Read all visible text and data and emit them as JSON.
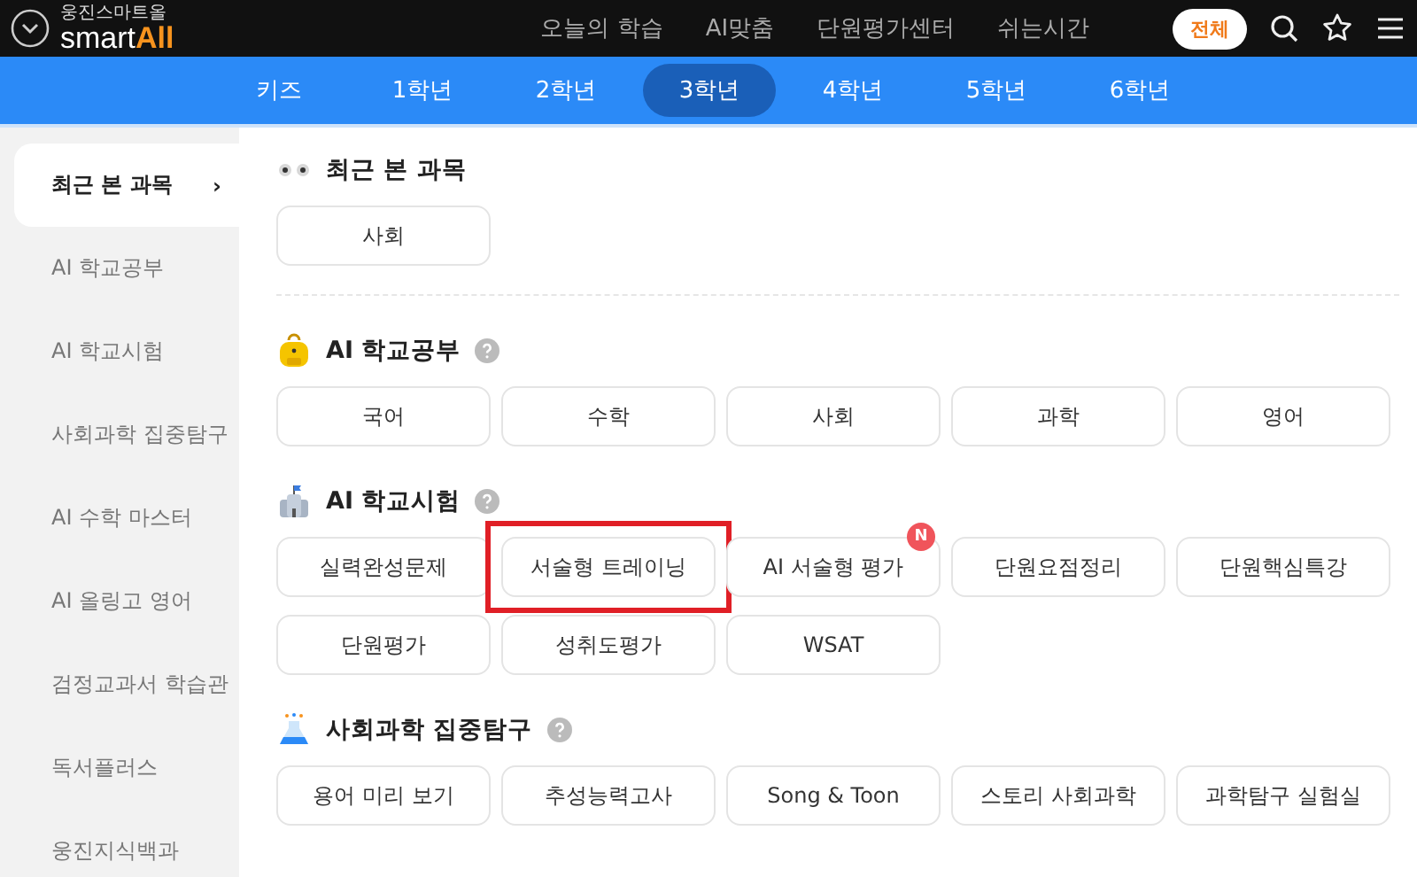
{
  "header": {
    "logo_caption": "웅진스마트올",
    "logo_text": "smart",
    "logo_accent": "All",
    "nav": [
      "오늘의 학습",
      "AI맞춤",
      "단원평가센터",
      "쉬는시간"
    ],
    "all_button": "전체"
  },
  "grades": [
    {
      "label": "키즈",
      "selected": false
    },
    {
      "label": "1학년",
      "selected": false
    },
    {
      "label": "2학년",
      "selected": false
    },
    {
      "label": "3학년",
      "selected": true
    },
    {
      "label": "4학년",
      "selected": false
    },
    {
      "label": "5학년",
      "selected": false
    },
    {
      "label": "6학년",
      "selected": false
    }
  ],
  "sidebar": [
    {
      "label": "최근 본 과목",
      "selected": true,
      "arrow": "›"
    },
    {
      "label": "AI 학교공부",
      "selected": false
    },
    {
      "label": "AI 학교시험",
      "selected": false
    },
    {
      "label": "사회과학 집중탐구",
      "selected": false
    },
    {
      "label": "AI 수학 마스터",
      "selected": false
    },
    {
      "label": "AI 올링고 영어",
      "selected": false
    },
    {
      "label": "검정교과서 학습관",
      "selected": false
    },
    {
      "label": "독서플러스",
      "selected": false
    },
    {
      "label": "웅진지식백과",
      "selected": false
    }
  ],
  "sections": [
    {
      "title": "최근 본 과목",
      "kind": "eyes",
      "help": false,
      "divider": true,
      "buttons": [
        {
          "label": "사회"
        }
      ]
    },
    {
      "title": "AI 학교공부",
      "kind": "bag",
      "help": true,
      "divider": false,
      "buttons": [
        {
          "label": "국어"
        },
        {
          "label": "수학"
        },
        {
          "label": "사회"
        },
        {
          "label": "과학"
        },
        {
          "label": "영어"
        }
      ]
    },
    {
      "title": "AI 학교시험",
      "kind": "school",
      "help": true,
      "divider": false,
      "buttons": [
        {
          "label": "실력완성문제"
        },
        {
          "label": "서술형 트레이닝",
          "highlighted": true
        },
        {
          "label": "AI 서술형 평가",
          "badge": "N"
        },
        {
          "label": "단원요점정리"
        },
        {
          "label": "단원핵심특강"
        },
        {
          "label": "단원평가"
        },
        {
          "label": "성취도평가"
        },
        {
          "label": "WSAT"
        }
      ]
    },
    {
      "title": "사회과학 집중탐구",
      "kind": "flask",
      "help": true,
      "divider": false,
      "buttons": [
        {
          "label": "용어 미리 보기"
        },
        {
          "label": "추성능력고사"
        },
        {
          "label": "Song & Toon"
        },
        {
          "label": "스토리 사회과학"
        },
        {
          "label": "과학탐구 실험실"
        }
      ]
    }
  ]
}
